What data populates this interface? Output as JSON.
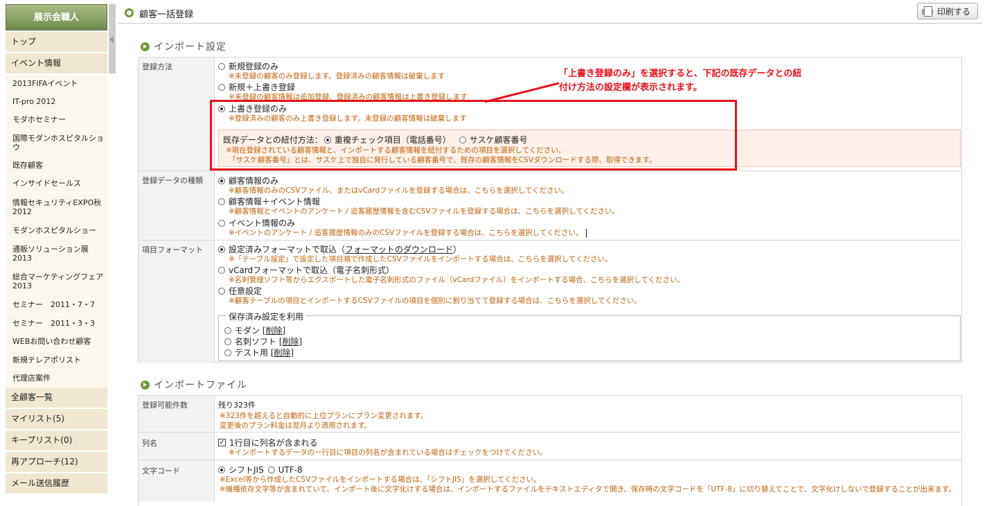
{
  "sidebar": {
    "title": "展示会職人",
    "items": [
      {
        "label": "トップ",
        "type": "main"
      },
      {
        "label": "イベント情報",
        "type": "main"
      },
      {
        "label": "2013FIFAイベント",
        "type": "sub"
      },
      {
        "label": "IT-pro 2012",
        "type": "sub"
      },
      {
        "label": "モダホセミナー",
        "type": "sub"
      },
      {
        "label": "国際モダンホスピタルショウ",
        "type": "sub"
      },
      {
        "label": "既存顧客",
        "type": "sub"
      },
      {
        "label": "インサイドセールス",
        "type": "sub"
      },
      {
        "label": "情報セキュリティEXPO秋2012",
        "type": "sub"
      },
      {
        "label": "モダンホスピタルショー",
        "type": "sub"
      },
      {
        "label": "通販ソリューション展2013",
        "type": "sub"
      },
      {
        "label": "総合マーケティングフェア2013",
        "type": "sub"
      },
      {
        "label": "セミナー　2011・7・7",
        "type": "sub"
      },
      {
        "label": "セミナー　2011・3・3",
        "type": "sub"
      },
      {
        "label": "WEBお問い合わせ顧客",
        "type": "sub"
      },
      {
        "label": "新規テレアポリスト",
        "type": "sub"
      },
      {
        "label": "代理店案件",
        "type": "sub"
      },
      {
        "label": "全顧客一覧",
        "type": "main"
      },
      {
        "label": "マイリスト(5)",
        "type": "main"
      },
      {
        "label": "キープリスト(0)",
        "type": "main"
      },
      {
        "label": "再アプローチ(12)",
        "type": "main"
      },
      {
        "label": "メール送信履歴",
        "type": "main"
      }
    ]
  },
  "header": {
    "title": "顧客一括登録",
    "print_label": "印刷する"
  },
  "import_settings": {
    "heading": "インポート設定",
    "reg_method": {
      "label": "登録方法",
      "options": [
        {
          "label": "新規登録のみ",
          "note": "※未登録の顧客のみ登録します。登録済みの顧客情報は破棄します",
          "selected": false
        },
        {
          "label": "新規＋上書き登録",
          "note": "※未登録の顧客情報は追加登録、登録済みの顧客情報は上書き登録します",
          "selected": false
        },
        {
          "label": "上書き登録のみ",
          "note": "※登録済みの顧客のみ上書き登録します。未登録の顧客情報は破棄します",
          "selected": true
        }
      ],
      "link_label": "既存データとの紐付方法：",
      "link_options": [
        {
          "label": "重複チェック項目（電話番号）",
          "selected": true
        },
        {
          "label": "サスケ顧客番号",
          "selected": false
        }
      ],
      "link_note1": "※現在登録されている顧客情報と、インポートする顧客情報を紐付するための項目を選択してください。",
      "link_note2": "「サスケ顧客番号」とは、サスケ上で独自に発行している顧客番号で、既存の顧客情報をCSVダウンロードする際、取得できます。"
    },
    "data_type": {
      "label": "登録データの種類",
      "options": [
        {
          "label": "顧客情報のみ",
          "note": "※顧客情報のみのCSVファイル、またはvCardファイルを登録する場合は、こちらを選択してください。",
          "selected": true
        },
        {
          "label": "顧客情報＋イベント情報",
          "note": "※顧客情報とイベントのアンケート / 追客履歴情報を含むCSVファイルを登録する場合は、こちらを選択してください。",
          "selected": false
        },
        {
          "label": "イベント情報のみ",
          "note": "※イベントのアンケート / 追客履歴情報のみのCSVファイルを登録する場合は、こちらを選択してください。",
          "selected": false
        }
      ]
    },
    "format": {
      "label": "項目フォーマット",
      "opt1_label": "設定済みフォーマットで取込（",
      "opt1_link": "フォーマットのダウンロード",
      "opt1_tail": "）",
      "opt1_note": "※「テーブル設定」で設定した項目順で作成したCSVファイルをインポートする場合は、こちらを選択してください。",
      "opt2_label": "vCardフォーマットで取込（電子名刺形式）",
      "opt2_note": "※名刺管理ソフト等からエクスポートした電子名刺形式のファイル（vCardファイル）をインポートする場合、こちらを選択してください。",
      "opt3_label": "任意設定",
      "opt3_note": "※顧客テーブルの項目とインポートするCSVファイルの項目を個別に割り当てて登録する場合は、こちらを選択してください。",
      "saved_legend": "保存済み設定を利用",
      "delete_label": "削除",
      "saved": [
        {
          "name": "モダン"
        },
        {
          "name": "名刺ソフト"
        },
        {
          "name": "テスト用"
        }
      ]
    }
  },
  "import_file": {
    "heading": "インポートファイル",
    "count": {
      "label": "登録可能件数",
      "value": "残り323件",
      "note1": "※323件を超えると自動的に上位プランにプラン変更されます。",
      "note2": "変更後のプラン料金は翌月より適用されます。"
    },
    "header_row": {
      "label": "列名",
      "checkbox_label": "1行目に列名が含まれる",
      "checked": true,
      "note": "※インポートするデータの一行目に項目の列名が含まれている場合はチェックをつけてください。"
    },
    "charset": {
      "label": "文字コード",
      "opt1": "シフトJIS",
      "opt2": "UTF-8",
      "note1": "※Excel等から作成したCSVファイルをインポートする場合は、「シフトJIS」を選択してください。",
      "note2": "※機種依存文字等が含まれていて、インポート後に文字化けする場合は、インポートするファイルをテキストエディタで開き、保存時の文字コードを「UTF-8」に切り替えてことで、文字化けしないで登録することが出来ます。"
    }
  },
  "callout": {
    "line1": "「上書き登録のみ」を選択すると、下記の既存データとの紐",
    "line2": "付け方法の設定欄が表示されます。"
  },
  "colors": {
    "accent": "#6c9b3e",
    "note": "#c0620a",
    "highlight": "#e8121b"
  }
}
